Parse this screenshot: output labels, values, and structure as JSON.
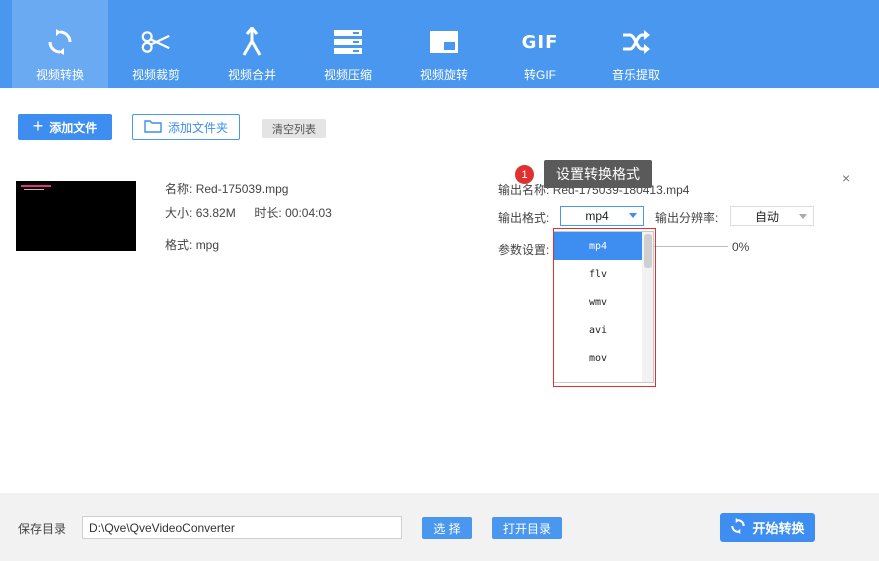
{
  "toolbar": {
    "items": [
      {
        "label": "视频转换",
        "icon": "refresh-icon"
      },
      {
        "label": "视频裁剪",
        "icon": "scissors-icon"
      },
      {
        "label": "视频合并",
        "icon": "merge-icon"
      },
      {
        "label": "视频压缩",
        "icon": "compress-icon"
      },
      {
        "label": "视频旋转",
        "icon": "rotate-icon"
      },
      {
        "label": "转GIF",
        "icon": "gif-icon",
        "icon_text": "GIF"
      },
      {
        "label": "音乐提取",
        "icon": "shuffle-icon"
      }
    ],
    "active_index": 0
  },
  "actions": {
    "add_file": "添加文件",
    "add_folder": "添加文件夹",
    "clear_list": "清空列表"
  },
  "file": {
    "name_label": "名称:",
    "name": "Red-175039.mpg",
    "size_label": "大小:",
    "size": "63.82M",
    "duration_label": "时长:",
    "duration": "00:04:03",
    "format_label": "格式:",
    "format": "mpg"
  },
  "output": {
    "name_label": "输出名称:",
    "name": "Red-175039-180413.mp4",
    "format_label": "输出格式:",
    "format_value": "mp4",
    "resolution_label": "输出分辨率:",
    "resolution_value": "自动",
    "params_label": "参数设置:",
    "progress_text": "0%",
    "close": "×"
  },
  "dropdown": {
    "options": [
      "mp4",
      "flv",
      "wmv",
      "avi",
      "mov",
      "..."
    ],
    "selected_index": 0
  },
  "tooltip": {
    "number": "1",
    "text": "设置转换格式"
  },
  "footer": {
    "save_label": "保存目录",
    "path": "D:\\Qve\\QveVideoConverter",
    "choose": "选 择",
    "open_dir": "打开目录",
    "start": "开始转换"
  },
  "colors": {
    "toolbar": "#4a97f0",
    "accent": "#3d8ef0",
    "highlight": "#e03030"
  }
}
